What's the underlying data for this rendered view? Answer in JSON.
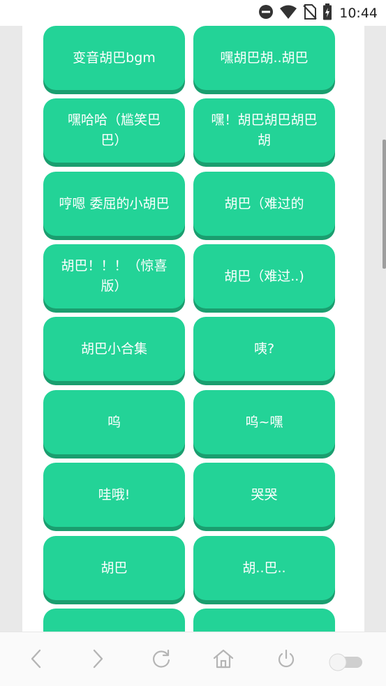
{
  "status_bar": {
    "time": "10:44",
    "icons": [
      "do-not-disturb-icon",
      "wifi-icon",
      "no-sim-icon",
      "battery-charging-icon"
    ]
  },
  "sound_buttons": [
    [
      "变音胡巴bgm",
      "嘿胡巴胡..胡巴"
    ],
    [
      "嘿哈哈（尴笑巴巴）",
      "嘿！胡巴胡巴胡巴胡"
    ],
    [
      "哼嗯 委屈的小胡巴",
      "胡巴（难过的"
    ],
    [
      "胡巴！！！（惊喜版）",
      "胡巴（难过..)"
    ],
    [
      "胡巴小合集",
      "咦?"
    ],
    [
      "呜",
      "呜~嘿"
    ],
    [
      "哇哦!",
      "哭哭"
    ],
    [
      "胡巴",
      "胡..巴.."
    ],
    [
      "",
      ""
    ]
  ],
  "bottom_bar": {
    "icons": [
      "back-icon",
      "forward-icon",
      "refresh-icon",
      "home-icon",
      "power-icon",
      "toggle-switch"
    ]
  },
  "colors": {
    "tile": "#23d397",
    "tile_shadow": "#1a9e6f",
    "frame": "#e9e9e9"
  }
}
